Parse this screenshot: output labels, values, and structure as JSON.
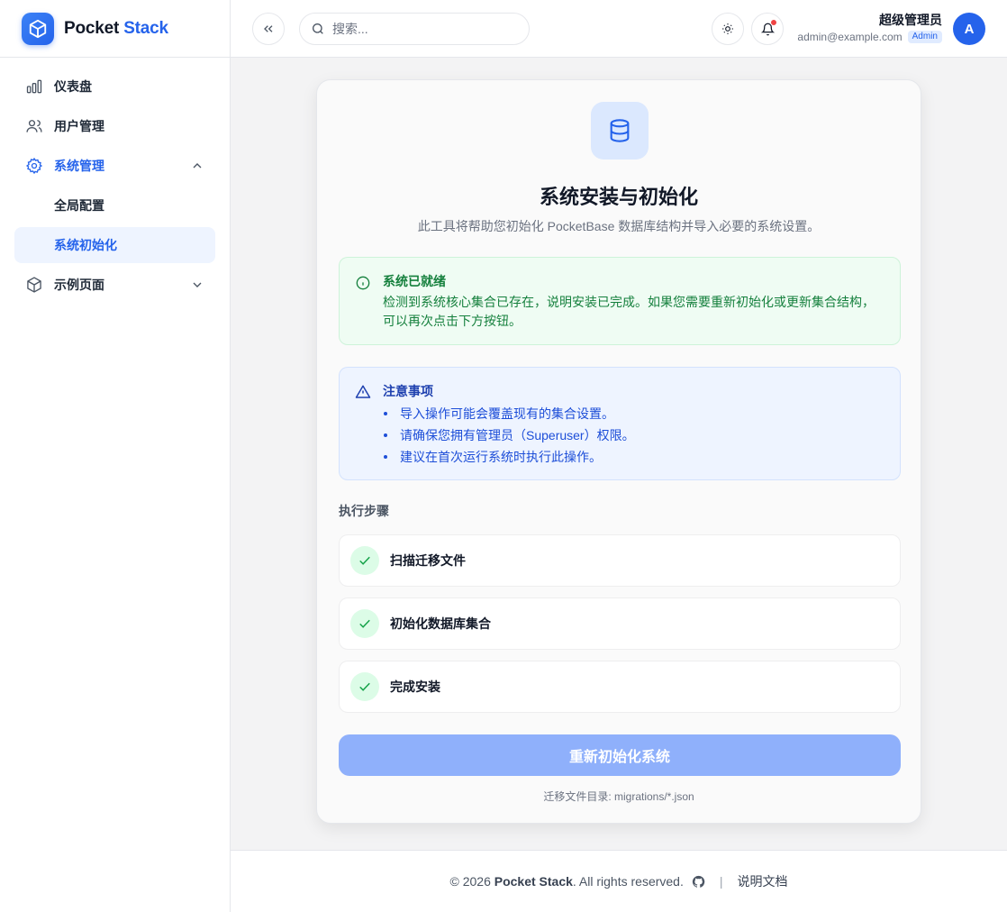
{
  "brand": {
    "name_part1": "Pocket",
    "name_part2": "Stack"
  },
  "sidebar": {
    "items": [
      {
        "label": "仪表盘",
        "icon": "bar-chart-icon"
      },
      {
        "label": "用户管理",
        "icon": "users-icon"
      },
      {
        "label": "系统管理",
        "icon": "gear-icon",
        "expanded": true,
        "children": [
          {
            "label": "全局配置"
          },
          {
            "label": "系统初始化",
            "active": true
          }
        ]
      },
      {
        "label": "示例页面",
        "icon": "box-icon",
        "expanded": false
      }
    ]
  },
  "header": {
    "search_placeholder": "搜索...",
    "user_name": "超级管理员",
    "user_email": "admin@example.com",
    "user_role": "Admin",
    "avatar_letter": "A"
  },
  "main": {
    "title": "系统安装与初始化",
    "subtitle": "此工具将帮助您初始化 PocketBase 数据库结构并导入必要的系统设置。",
    "status_alert": {
      "title": "系统已就绪",
      "body_line1": "检测到系统核心集合已存在，说明安装已完成。如果您需要重新初始化或更新集合结构，",
      "body_line2": "可以再次点击下方按钮。"
    },
    "note_alert": {
      "title": "注意事项",
      "items": [
        "导入操作可能会覆盖现有的集合设置。",
        "请确保您拥有管理员（Superuser）权限。",
        "建议在首次运行系统时执行此操作。"
      ]
    },
    "steps_title": "执行步骤",
    "steps": [
      {
        "label": "扫描迁移文件",
        "status": "done"
      },
      {
        "label": "初始化数据库集合",
        "status": "done"
      },
      {
        "label": "完成安装",
        "status": "done"
      }
    ],
    "reinit_button": "重新初始化系统",
    "migrations_note": "迁移文件目录: migrations/*.json"
  },
  "footer": {
    "copyright_prefix": "© 2026 ",
    "copyright_brand": "Pocket Stack",
    "copyright_suffix": ". All rights reserved.",
    "docs_link": "说明文档"
  },
  "colors": {
    "accent": "#2563eb",
    "success": "#15803d",
    "info": "#1d4ed8",
    "button_disabled": "#8fb0fb"
  }
}
